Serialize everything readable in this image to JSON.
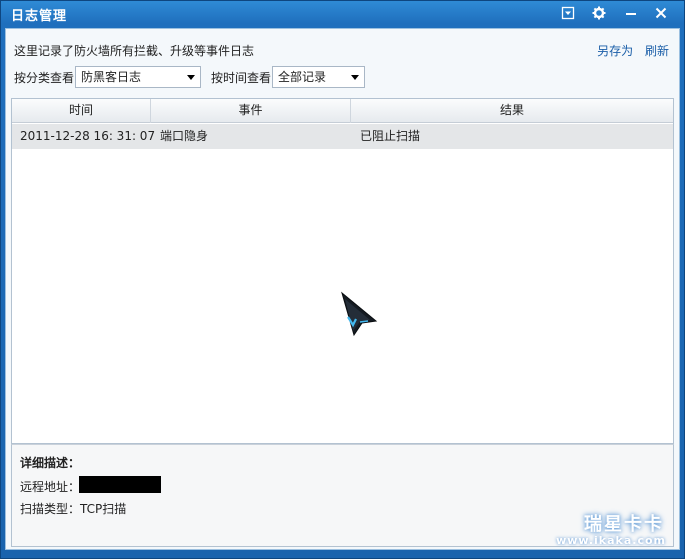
{
  "window": {
    "title": "日志管理",
    "buttons": [
      "dropdown-icon",
      "gear-icon",
      "minimize-icon",
      "close-icon"
    ]
  },
  "header": {
    "description": "这里记录了防火墙所有拦截、升级等事件日志",
    "save_as": "另存为",
    "refresh": "刷新"
  },
  "filters": {
    "category_label": "按分类查看",
    "category_value": "防黑客日志",
    "time_label": "按时间查看",
    "time_value": "全部记录"
  },
  "table": {
    "columns": [
      "时间",
      "事件",
      "结果"
    ],
    "rows": [
      {
        "time": "2011-12-28 16: 31: 07",
        "event": "端口隐身",
        "result": "已阻止扫描"
      }
    ]
  },
  "detail": {
    "title": "详细描述：",
    "remote_label": "远程地址：",
    "scan_type_label": "扫描类型：",
    "scan_type_value": "TCP扫描"
  },
  "watermark": {
    "main": "瑞星卡卡",
    "url": "www.ikaka.com"
  },
  "colors": {
    "titlebar": "#1f6fbd",
    "link": "#1a5ea8",
    "row_highlight": "#e4e6e8"
  }
}
